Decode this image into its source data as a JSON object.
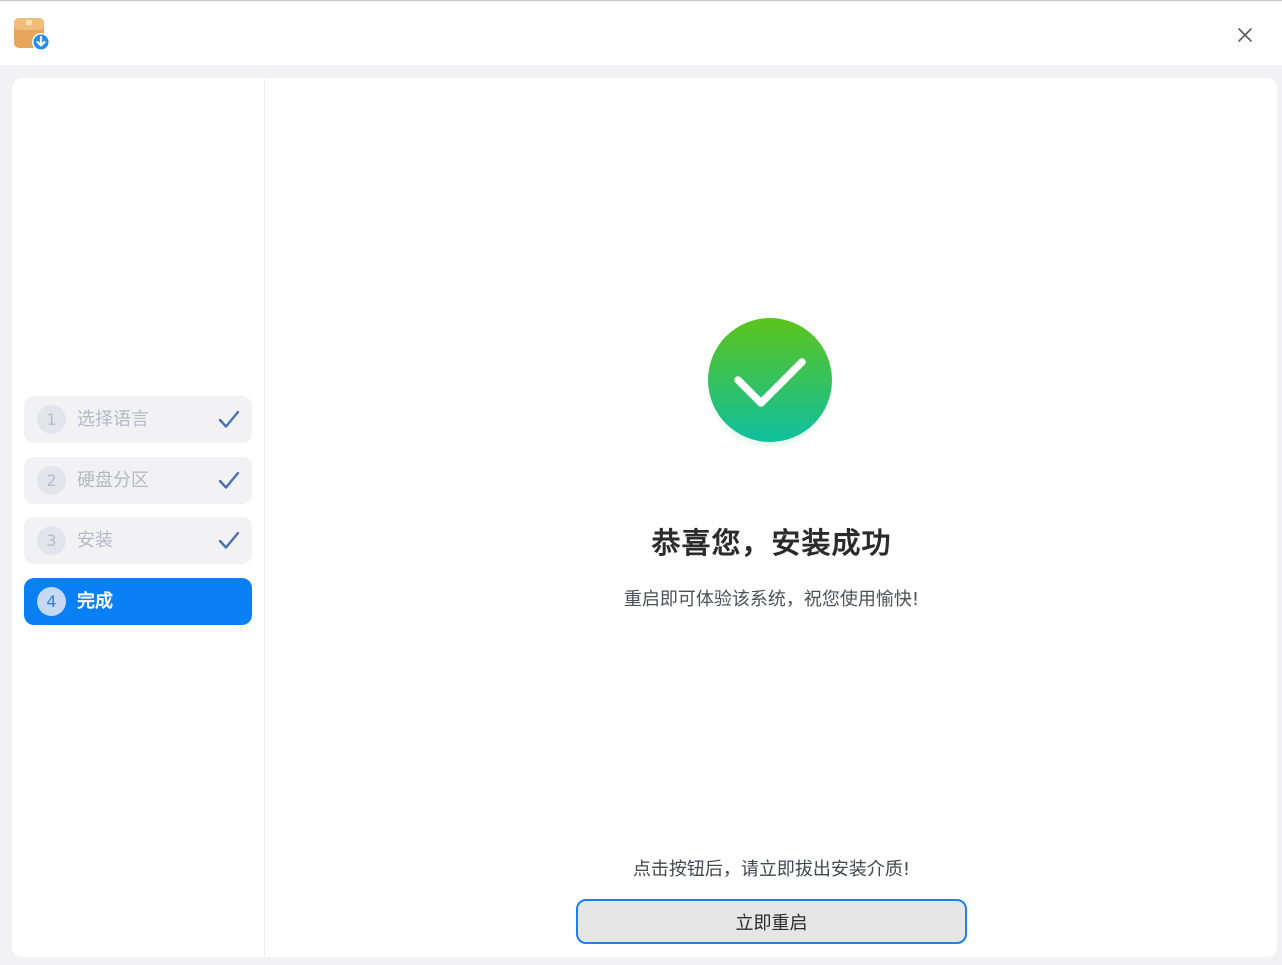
{
  "window": {
    "app_icon": "installer-package-download-icon",
    "close_icon": "close-icon"
  },
  "steps": [
    {
      "number": "1",
      "label": "选择语言",
      "done": true
    },
    {
      "number": "2",
      "label": "硬盘分区",
      "done": true
    },
    {
      "number": "3",
      "label": "安装",
      "done": true
    },
    {
      "number": "4",
      "label": "完成",
      "done": false,
      "active": true
    }
  ],
  "main": {
    "status_icon": "success-check-icon",
    "title": "恭喜您，安装成功",
    "subtitle": "重启即可体验该系统，祝您使用愉快!",
    "notice": "点击按钮后，请立即拔出安装介质!",
    "reboot_label": "立即重启"
  },
  "colors": {
    "accent": "#0a80f5",
    "success_top": "#5cc41c",
    "success_bottom": "#0fbf9f",
    "check_done": "#4a6fb5"
  }
}
